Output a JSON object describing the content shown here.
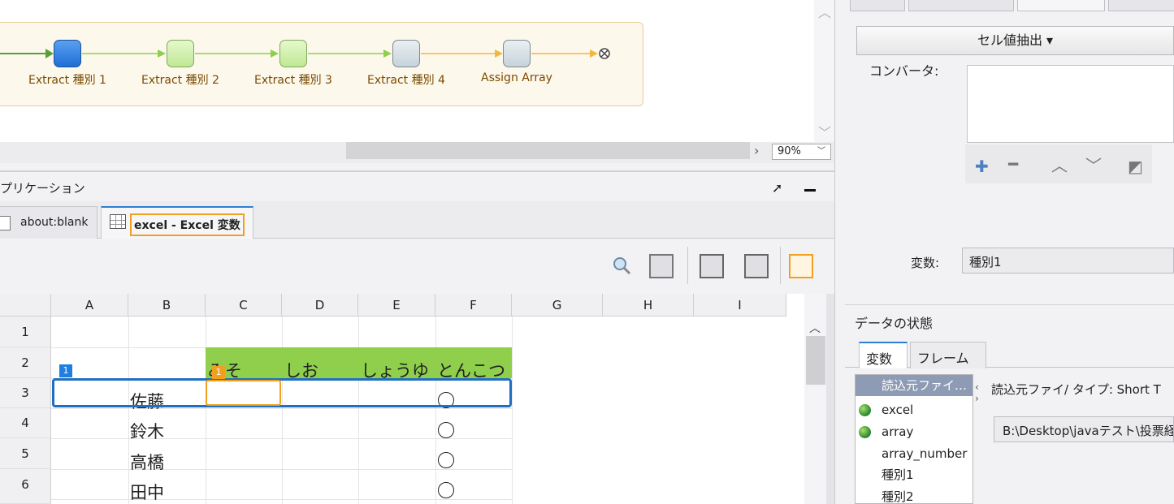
{
  "workflow": {
    "nodes": [
      {
        "label": "Extract 種別 1",
        "state": "active"
      },
      {
        "label": "Extract 種別 2",
        "state": "done"
      },
      {
        "label": "Extract 種別 3",
        "state": "done"
      },
      {
        "label": "Extract 種別 4",
        "state": "pending"
      },
      {
        "label": "Assign Array",
        "state": "pending"
      }
    ],
    "zoom": "90%",
    "colors": {
      "active_arrow": "#8ecf4c",
      "pending_arrow": "#f0b840",
      "start_arrow": "#5a9e3a"
    }
  },
  "app_panel": {
    "title": "プリケーション",
    "tabs": [
      {
        "label": "about:blank"
      },
      {
        "label": "excel - Excel 変数"
      }
    ]
  },
  "sheet": {
    "columns": [
      "A",
      "B",
      "C",
      "D",
      "E",
      "F",
      "G",
      "H",
      "I"
    ],
    "rows": [
      "1",
      "2",
      "3",
      "4",
      "5",
      "6"
    ],
    "row2": {
      "C": "みそ",
      "D": "しお",
      "E": "しょうゆ",
      "F": "とんこつ"
    },
    "names": [
      "佐藤",
      "鈴木",
      "高橋",
      "田中"
    ],
    "circle_glyph": "○",
    "badges": {
      "row": "1",
      "cell": "1"
    },
    "colors": {
      "header_fill": "#8fcf4c",
      "row_selection": "#1f6fc2",
      "cell_selection": "#f0a020"
    }
  },
  "properties": {
    "cell_extract_label": "セル値抽出 ▾",
    "converter_label": "コンバータ:",
    "variable_label": "変数:",
    "variable_value": "種別1"
  },
  "data_state": {
    "title": "データの状態",
    "tabs": [
      "変数",
      "フレーム"
    ],
    "variables": [
      {
        "name": "読込元ファイ…",
        "selected": true,
        "globe": false
      },
      {
        "name": "excel",
        "selected": false,
        "globe": true
      },
      {
        "name": "array",
        "selected": false,
        "globe": true
      },
      {
        "name": "array_number",
        "selected": false,
        "globe": false
      },
      {
        "name": "種別1",
        "selected": false,
        "globe": false
      },
      {
        "name": "種別2",
        "selected": false,
        "globe": false
      }
    ],
    "detail": "読込元ファイ/ タイプ: Short T",
    "path": "B:\\Desktop\\javaテスト\\投票経"
  }
}
